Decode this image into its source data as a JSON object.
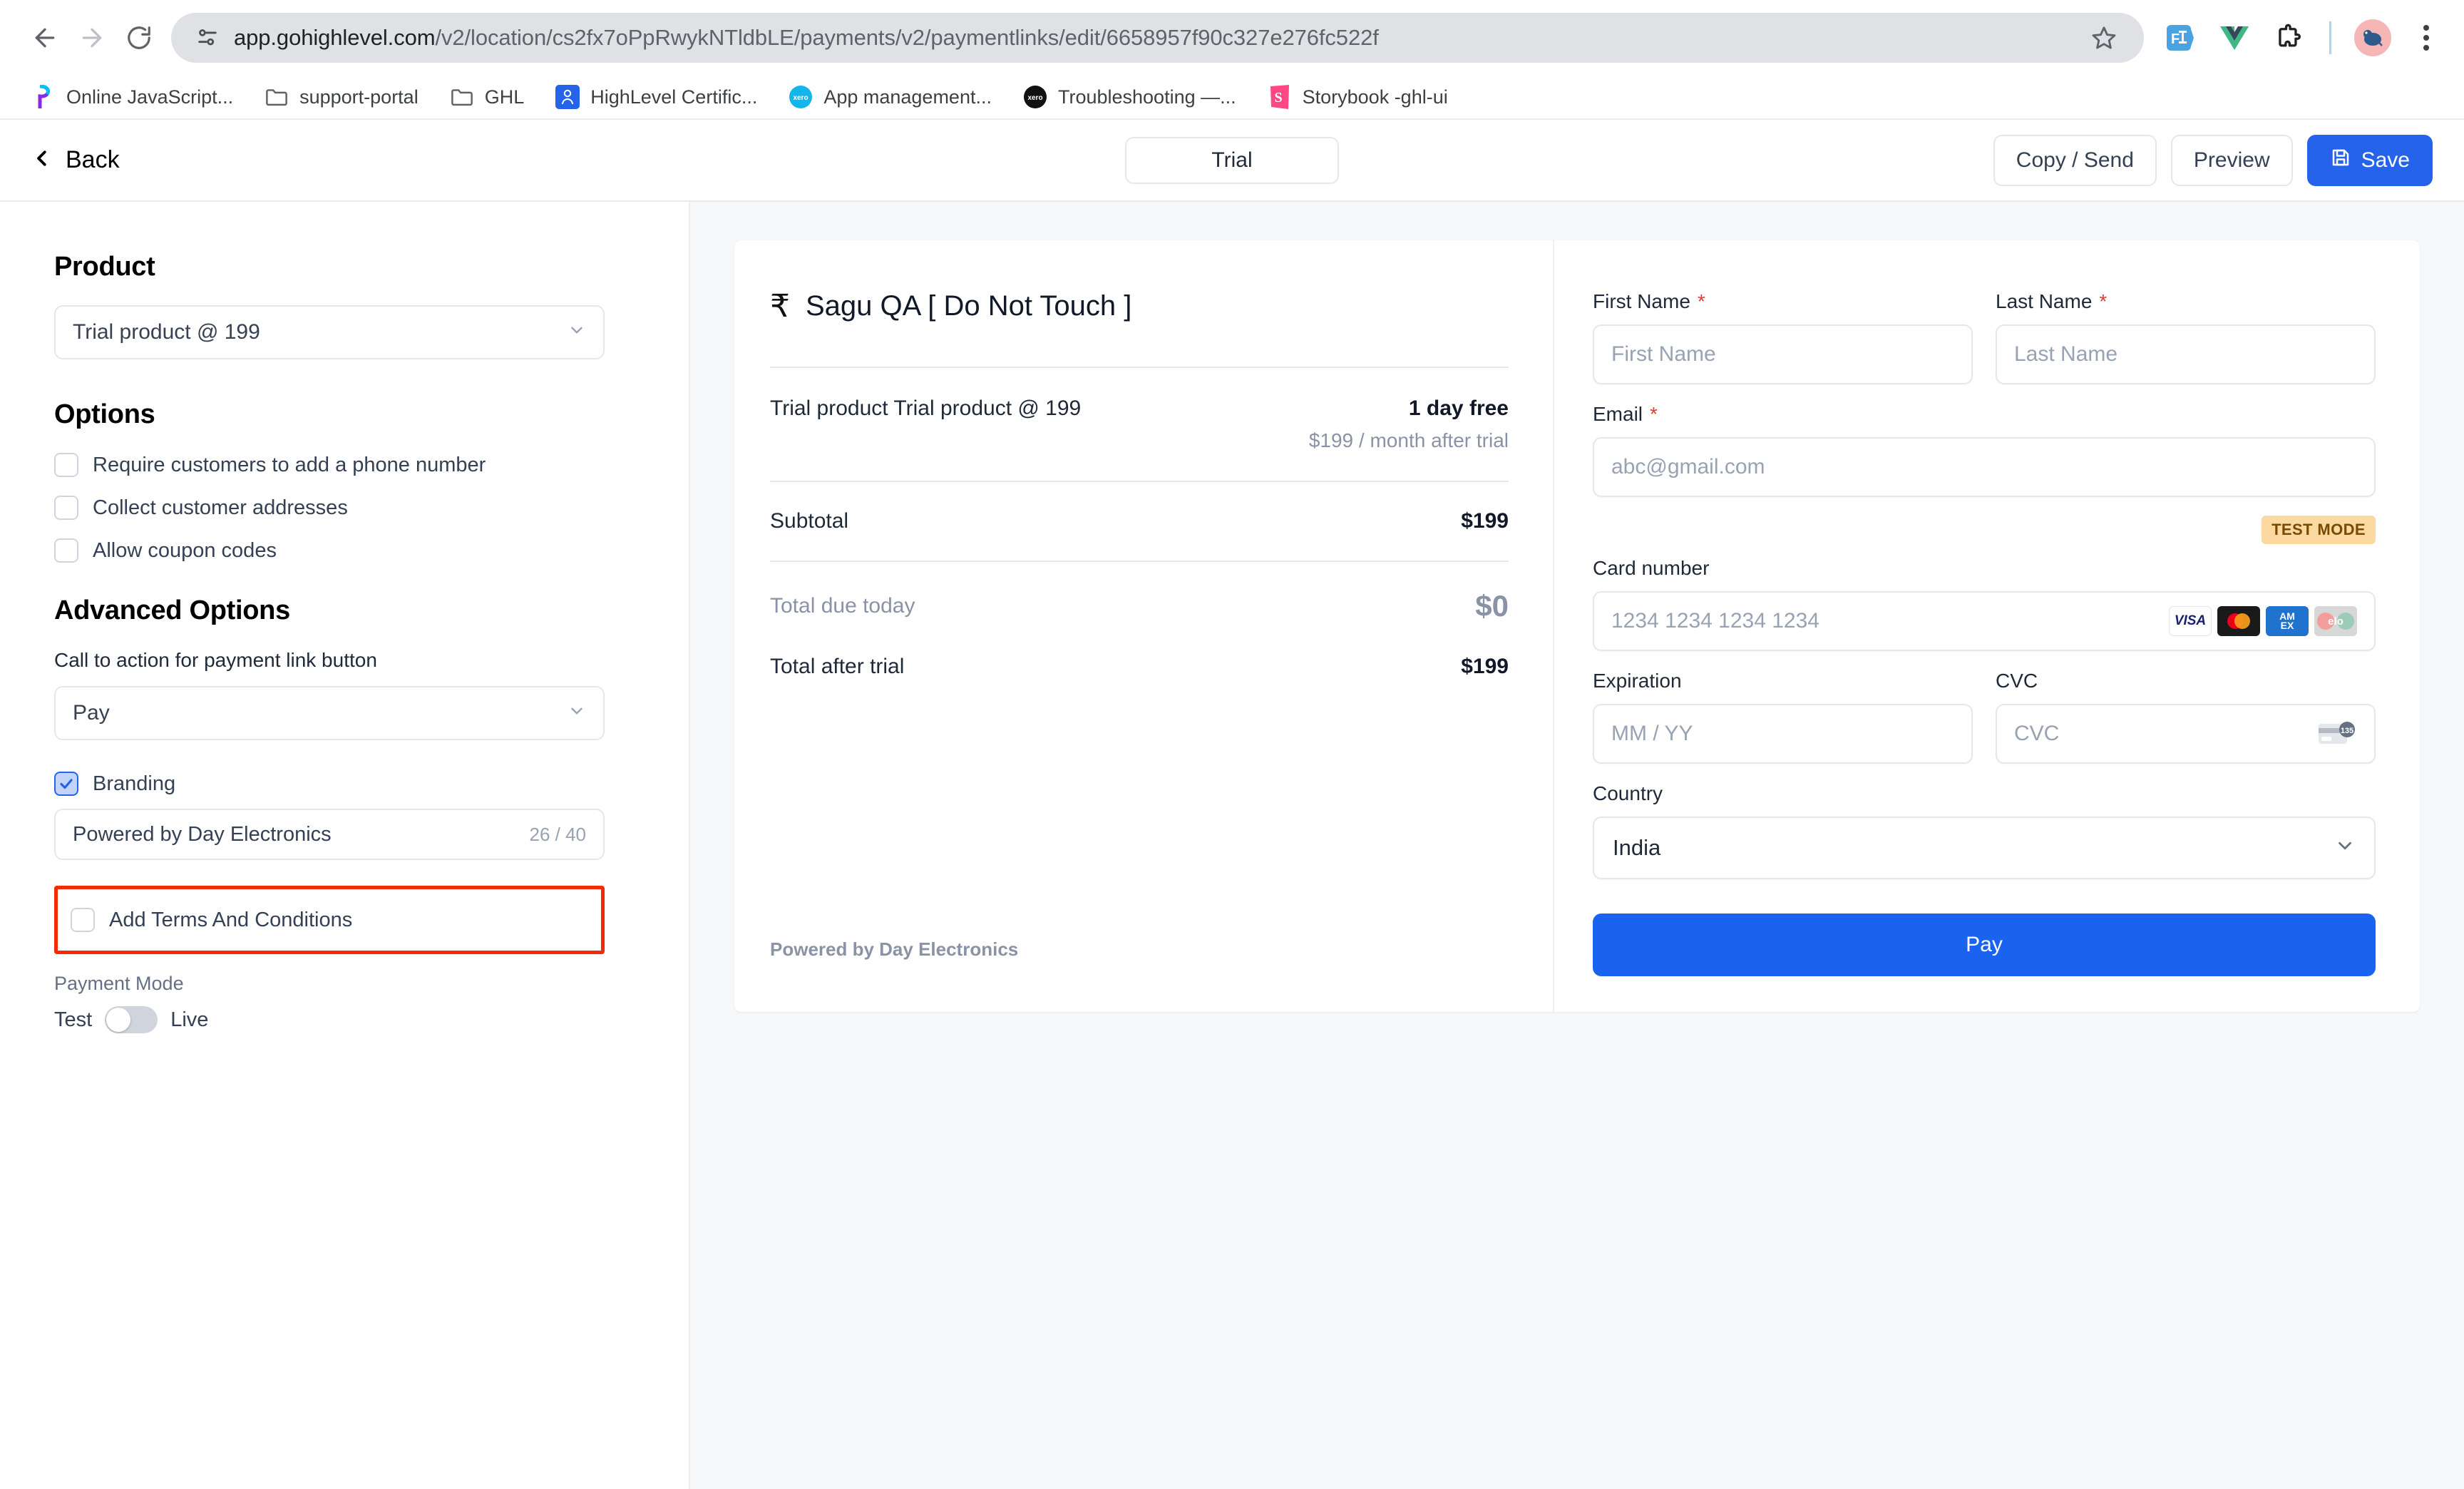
{
  "browser": {
    "url_host": "app.gohighlevel.com",
    "url_path": "/v2/location/cs2fx7oPpRwykNTldbLE/payments/v2/paymentlinks/edit/6658957f90c327e276fc522f",
    "bookmarks": [
      {
        "label": "Online JavaScript...",
        "icon": "postman-icon"
      },
      {
        "label": "support-portal",
        "icon": "folder-icon"
      },
      {
        "label": "GHL",
        "icon": "folder-icon"
      },
      {
        "label": "HighLevel Certific...",
        "icon": "highlevel-icon"
      },
      {
        "label": "App management...",
        "icon": "xero-blue-icon"
      },
      {
        "label": "Troubleshooting —...",
        "icon": "xero-black-icon"
      },
      {
        "label": "Storybook -ghl-ui",
        "icon": "storybook-icon"
      }
    ]
  },
  "header": {
    "back_label": "Back",
    "tab_label": "Trial",
    "copy_send_label": "Copy / Send",
    "preview_label": "Preview",
    "save_label": "Save"
  },
  "sidebar": {
    "product_title": "Product",
    "product_value": "Trial product @ 199",
    "options_title": "Options",
    "options": [
      {
        "label": "Require customers to add a phone number",
        "checked": false
      },
      {
        "label": "Collect customer addresses",
        "checked": false
      },
      {
        "label": "Allow coupon codes",
        "checked": false
      }
    ],
    "advanced_title": "Advanced Options",
    "cta_label": "Call to action for payment link button",
    "cta_value": "Pay",
    "branding_label": "Branding",
    "branding_checked": true,
    "branding_value": "Powered by Day Electronics",
    "branding_counter": "26 / 40",
    "terms_label": "Add Terms And Conditions",
    "terms_checked": false,
    "payment_mode_label": "Payment Mode",
    "mode_test": "Test",
    "mode_live": "Live",
    "highlight_color": "#f42a00"
  },
  "checkout": {
    "currency_symbol": "₹",
    "merchant_name": "Sagu QA [ Do Not Touch ]",
    "line_item": {
      "name": "Trial product Trial product @ 199",
      "primary": "1 day free",
      "secondary": "$199 / month after trial"
    },
    "subtotal_label": "Subtotal",
    "subtotal_value": "$199",
    "due_today_label": "Total due today",
    "due_today_value": "$0",
    "after_trial_label": "Total after trial",
    "after_trial_value": "$199",
    "footer": "Powered by Day Electronics"
  },
  "payment_form": {
    "first_name_label": "First Name",
    "first_name_placeholder": "First Name",
    "last_name_label": "Last Name",
    "last_name_placeholder": "Last Name",
    "email_label": "Email",
    "email_placeholder": "abc@gmail.com",
    "required_mark": "*",
    "test_mode_badge": "TEST MODE",
    "card_label": "Card number",
    "card_placeholder": "1234 1234 1234 1234",
    "expiration_label": "Expiration",
    "expiration_placeholder": "MM / YY",
    "cvc_label": "CVC",
    "cvc_placeholder": "CVC",
    "country_label": "Country",
    "country_value": "India",
    "pay_button": "Pay",
    "brands": [
      "VISA",
      "mastercard",
      "AMEX",
      "elo"
    ]
  }
}
